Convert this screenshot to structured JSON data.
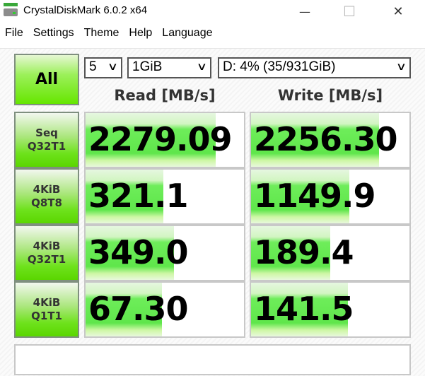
{
  "window": {
    "title": "CrystalDiskMark 6.0.2 x64",
    "minimize": "—",
    "maximize": "☐",
    "close": "✕"
  },
  "menu": [
    "File",
    "Settings",
    "Theme",
    "Help",
    "Language"
  ],
  "controls": {
    "all_label": "All",
    "count": "5",
    "size": "1GiB",
    "drive": "D: 4% (35/931GiB)"
  },
  "headers": {
    "read": "Read [MB/s]",
    "write": "Write [MB/s]"
  },
  "tests": [
    {
      "line1": "Seq",
      "line2": "Q32T1",
      "read": "2279.09",
      "write": "2256.30",
      "read_fill": 0.82,
      "write_fill": 0.81
    },
    {
      "line1": "4KiB",
      "line2": "Q8T8",
      "read": "321.1",
      "write": "1149.9",
      "read_fill": 0.49,
      "write_fill": 0.62
    },
    {
      "line1": "4KiB",
      "line2": "Q32T1",
      "read": "349.0",
      "write": "189.4",
      "read_fill": 0.56,
      "write_fill": 0.5
    },
    {
      "line1": "4KiB",
      "line2": "Q1T1",
      "read": "67.30",
      "write": "141.5",
      "read_fill": 0.48,
      "write_fill": 0.61
    }
  ],
  "comment": ""
}
